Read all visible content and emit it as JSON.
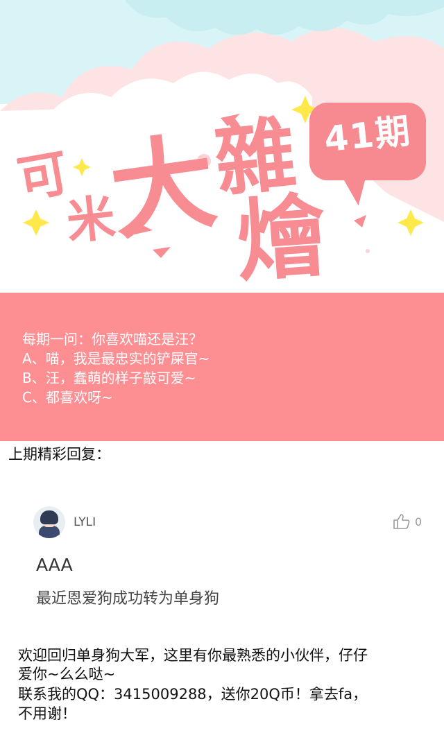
{
  "banner": {
    "title_chars": [
      "可",
      "米",
      "大",
      "雜",
      "燴"
    ],
    "issue_badge": "41期",
    "colors": {
      "pink": "#f78c92",
      "sky": "#d9f4f6",
      "cloud_pink": "#fde3e4"
    }
  },
  "question": {
    "lines": [
      "每期一问：你喜欢喵还是汪？",
      "A、喵，我是最忠实的铲屎官~",
      "B、汪，蠢萌的样子敲可爱~",
      "C、都喜欢呀~"
    ],
    "background": "#fd8f93"
  },
  "last_reply": {
    "section_title": "上期精彩回复：",
    "username": "LYLI",
    "like_count": "0",
    "text_main": "AAA",
    "text_sub": "最近恩爱狗成功转为单身狗"
  },
  "footer": {
    "lines": [
      "欢迎回归单身狗大军，这里有你最熟悉的小伙伴，仔仔",
      "爱你~么么哒~",
      "联系我的QQ：3415009288，送你20Q币！拿去fa，",
      "不用谢！"
    ]
  }
}
